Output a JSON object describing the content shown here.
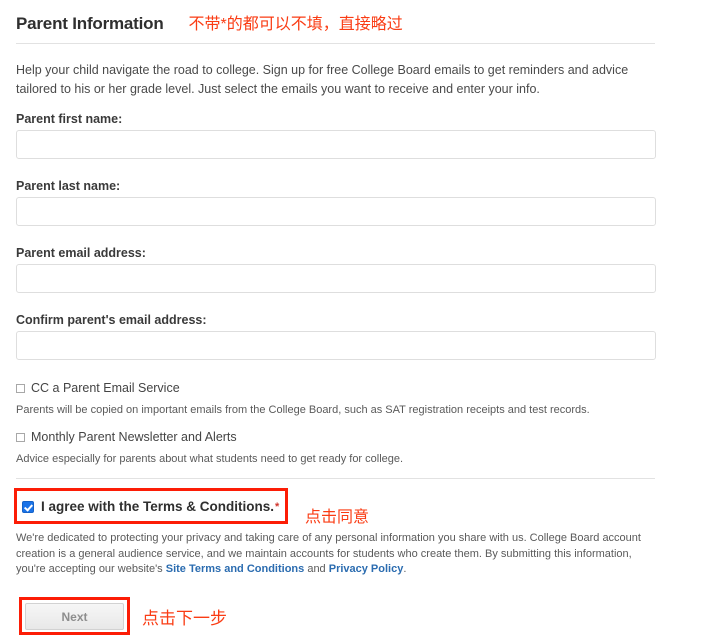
{
  "header": {
    "title": "Parent Information",
    "annotation": "不带*的都可以不填，直接略过"
  },
  "intro": "Help your child navigate the road to college. Sign up for free College Board emails to get reminders and advice tailored to his or her grade level. Just select the emails you want to receive and enter your info.",
  "fields": [
    {
      "label": "Parent first name:",
      "value": "",
      "placeholder": ""
    },
    {
      "label": "Parent last name:",
      "value": "",
      "placeholder": ""
    },
    {
      "label": "Parent email address:",
      "value": "",
      "placeholder": ""
    },
    {
      "label": "Confirm parent's email address:",
      "value": "",
      "placeholder": ""
    }
  ],
  "optins": [
    {
      "label": "CC a Parent Email Service",
      "description": "Parents will be copied on important emails from the College Board, such as SAT registration receipts and test records.",
      "checked": false
    },
    {
      "label": "Monthly Parent Newsletter and Alerts",
      "description": "Advice especially for parents about what students need to get ready for college.",
      "checked": false
    }
  ],
  "terms": {
    "label": "I agree with the Terms & Conditions.",
    "required_marker": "*",
    "checked": true,
    "annotation": "点击同意"
  },
  "privacy": {
    "part1": "We're dedicated to protecting your privacy and taking care of any personal information you share with us. College Board account creation is a general audience service, and we maintain accounts for students who create them. By submitting this information, you're accepting our website's ",
    "link1": "Site Terms and Conditions",
    "conjunction": " and ",
    "link2": "Privacy Policy",
    "part2": "."
  },
  "next": {
    "label": "Next",
    "annotation": "点击下一步"
  },
  "colors": {
    "annotation_red": "#fa3c14",
    "box_red": "#fc1d06",
    "checkbox_blue": "#1a73e8",
    "link_blue": "#2b6cb0"
  }
}
